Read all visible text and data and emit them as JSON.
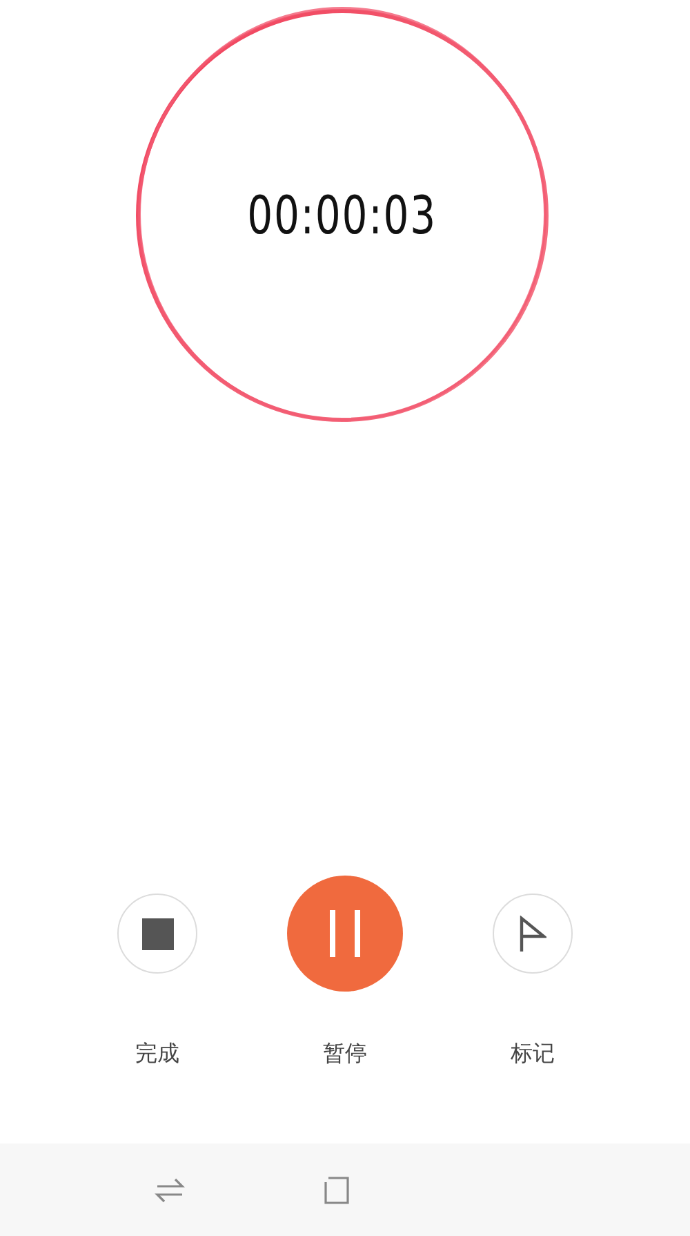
{
  "timer": {
    "elapsed": "00:00:03"
  },
  "controls": [
    {
      "kind": "stop",
      "label": "完成"
    },
    {
      "kind": "pause",
      "label": "暂停"
    },
    {
      "kind": "flag",
      "label": "标记"
    }
  ],
  "nav_bar": [
    {
      "kind": "switch"
    },
    {
      "kind": "home"
    }
  ]
}
